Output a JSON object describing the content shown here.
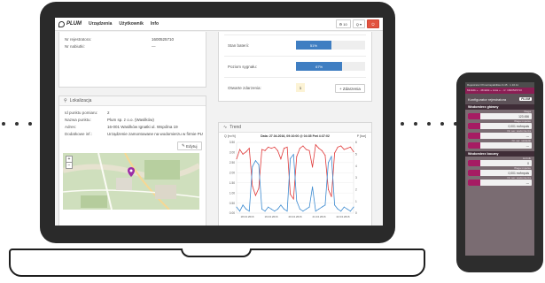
{
  "app": {
    "brand": "PLUM",
    "nav": [
      "Urządzenia",
      "Użytkownik",
      "Info"
    ],
    "nav_right": {
      "notif_count": "10",
      "search": "Q"
    }
  },
  "device_panel": {
    "rows": [
      {
        "label": "Nr rejestratora:",
        "value": "1600525710"
      },
      {
        "label": "Nr nabiutki:",
        "value": "—"
      }
    ]
  },
  "status_panel": {
    "stan_baterii": {
      "label": "Stan baterii:",
      "percent": 51,
      "text": "51%"
    },
    "poziom_sygnalu": {
      "label": "Poziom sygnału:",
      "percent": 67,
      "text": "67%"
    },
    "alarms": {
      "label": "Otwarte zdarzenia:",
      "count": "1",
      "button": "+ Zdarzenia"
    }
  },
  "location_panel": {
    "title": "Lokalizacja",
    "rows": [
      {
        "label": "Id punktu pomiaru:",
        "value": "2"
      },
      {
        "label": "Nazwa punktu:",
        "value": "Plum sp. z o.o. (Wasilków)",
        "link": true
      },
      {
        "label": "Adres:",
        "value": "16-001 Wasilków Ignatki ul. Wspólna 19"
      },
      {
        "label": "Dodatkowe inf.:",
        "value": "Urządzenie zamontowane na wodomierzu w firmie PLUM Sp. z o.o."
      }
    ],
    "edit_button": "Edytuj"
  },
  "trend_panel": {
    "title": "Trend",
    "chart_title": "Data: 27.04.2016, 09:10:00 @ 04:35 Pwt 4:37:02",
    "left_label": "Q [m³/h]",
    "right_label": "P [bar]"
  },
  "chart_data": {
    "type": "line",
    "title": "Data: 27.04.2016, 09:10:00 @ 04:35 Pwt 4:37:02",
    "ylabel": "Q [m³/h]",
    "y2label": "P [bar]",
    "ylim": [
      0,
      3.5
    ],
    "y2lim": [
      0,
      6
    ],
    "yticks": [
      "3.50",
      "3.00",
      "2.50",
      "2.00",
      "1.50",
      "1.00",
      "0.50",
      "0.00"
    ],
    "y2ticks": [
      "6",
      "5",
      "4",
      "3",
      "2",
      "1",
      "0"
    ],
    "x_ticks": [
      "18.04.2016",
      "19.04.2016",
      "20.04.2016",
      "21.04.2016",
      "22.04.2016"
    ],
    "series": [
      {
        "color": "#e03a3a",
        "axis": "y2",
        "values": [
          4.6,
          5.4,
          5.0,
          5.2,
          5.5,
          2.3,
          1.5,
          2.1,
          5.4,
          5.3,
          5.6,
          5.5,
          5.6,
          5.3,
          4.6,
          5.5,
          5.6,
          1.6,
          1.2,
          4.8,
          5.5,
          5.7,
          5.4,
          5.3,
          3.9,
          5.8,
          5.5,
          5.3,
          4.9,
          2.0,
          1.4,
          5.1,
          5.6,
          5.7,
          5.4,
          5.5,
          5.6,
          5.2
        ]
      },
      {
        "color": "#3d8bd0",
        "axis": "y",
        "values": [
          0.3,
          0.1,
          0.4,
          0.2,
          0.1,
          2.3,
          2.6,
          2.4,
          0.2,
          0.1,
          0.3,
          0.2,
          0.1,
          0.2,
          0.4,
          0.2,
          0.1,
          2.7,
          2.9,
          0.6,
          0.2,
          0.1,
          0.2,
          0.3,
          1.3,
          0.1,
          0.2,
          0.3,
          0.4,
          2.5,
          2.8,
          0.4,
          0.2,
          0.1,
          0.3,
          0.2,
          0.1,
          0.3
        ]
      }
    ]
  },
  "phone": {
    "top": "Rejestrator PrimeCapabilities 9.45 · 1.16.11",
    "crumb": "Miniklik » ...Miniklik » Lista » ...rz: 1600525710",
    "header": "Konfigurator rejestratora",
    "logo": "PLUM",
    "section1": "Wodomierz główny",
    "fields1": [
      {
        "label": "Waga",
        "value": "123 456"
      },
      {
        "label": "Waga impulsu",
        "value": "0,001 m³/impuls"
      },
      {
        "label": "Nr. ser. wodomierza",
        "value": "—"
      },
      {
        "label": "Nr. ser. nakładki",
        "value": "—"
      }
    ],
    "section2": "Wodomierz boczny",
    "fields2": [
      {
        "label": "Licznik",
        "value": "0"
      },
      {
        "label": "Waga impulsu",
        "value": "0,001 m³/impuls"
      },
      {
        "label": "Nr. ser. wodomierza",
        "value": "—"
      }
    ]
  },
  "colors": {
    "accent_blue": "#3f7ec2",
    "accent_red": "#e2533f",
    "phone_magenta": "#a61b63"
  }
}
